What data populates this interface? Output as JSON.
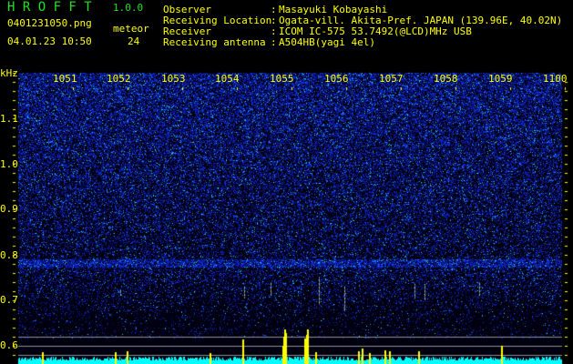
{
  "app": {
    "name": "H R O F F T",
    "version": "1.0.0",
    "filename": "0401231050.png",
    "datetime": "04.01.23 10:50",
    "count_label": "meteor",
    "count": "24"
  },
  "info": [
    {
      "label": "Observer",
      "value": "Masayuki Kobayashi"
    },
    {
      "label": "Receiving Location",
      "value": "Ogata-vill. Akita-Pref. JAPAN (139.96E, 40.02N)"
    },
    {
      "label": "Receiver",
      "value": "ICOM IC-575 53.7492(@LCD)MHz USB"
    },
    {
      "label": "Receiving antenna",
      "value": "A504HB(yagi 4el)"
    }
  ],
  "axis": {
    "unit": "kHz",
    "y_ticks": [
      "1.1",
      "1.0",
      "0.9",
      "0.8",
      "0.7",
      "0.6"
    ],
    "time_ticks": [
      "1051",
      "1052",
      "1053",
      "1054",
      "1055",
      "1056",
      "1057",
      "1058",
      "1059",
      "1100"
    ]
  },
  "colors": {
    "title": "#22e022",
    "text": "#ffff00",
    "noise": "#1030e0",
    "counts": "#00ffff",
    "meteor": "#ffff00"
  }
}
